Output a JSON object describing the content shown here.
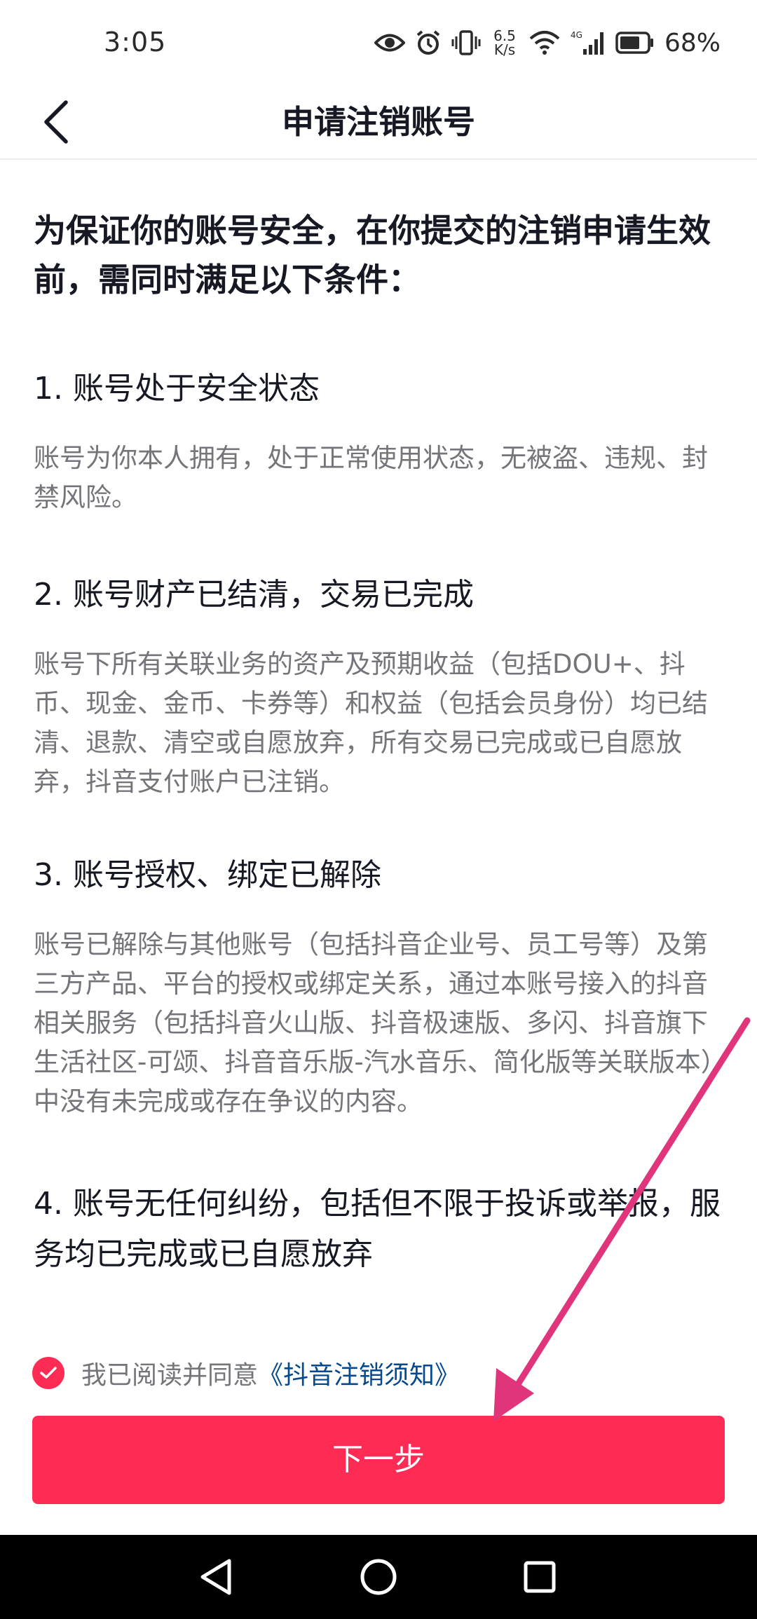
{
  "status_bar": {
    "time": "3:05",
    "net_speed_value": "6.5",
    "net_speed_unit": "K/s",
    "network_type": "4G",
    "battery_percent": "68%"
  },
  "header": {
    "title": "申请注销账号"
  },
  "content": {
    "intro": "为保证你的账号安全，在你提交的注销申请生效前，需同时满足以下条件：",
    "sections": [
      {
        "heading": "1. 账号处于安全状态",
        "body": "账号为你本人拥有，处于正常使用状态，无被盗、违规、封禁风险。"
      },
      {
        "heading": "2. 账号财产已结清，交易已完成",
        "body": "账号下所有关联业务的资产及预期收益（包括DOU+、抖币、现金、金币、卡券等）和权益（包括会员身份）均已结清、退款、清空或自愿放弃，所有交易已完成或已自愿放弃，抖音支付账户已注销。"
      },
      {
        "heading": "3. 账号授权、绑定已解除",
        "body": "账号已解除与其他账号（包括抖音企业号、员工号等）及第三方产品、平台的授权或绑定关系，通过本账号接入的抖音相关服务（包括抖音火山版、抖音极速版、多闪、抖音旗下生活社区-可颂、抖音音乐版-汽水音乐、简化版等关联版本）中没有未完成或存在争议的内容。"
      },
      {
        "heading": "4. 账号无任何纠纷，包括但不限于投诉或举报，服务均已完成或已自愿放弃"
      }
    ]
  },
  "agreement": {
    "checked": true,
    "text": "我已阅读并同意",
    "link_text": "《抖音注销须知》"
  },
  "primary_button": {
    "label": "下一步"
  },
  "colors": {
    "accent": "#fe2c55",
    "link": "#04498d",
    "annotation_arrow": "#e0357a"
  }
}
